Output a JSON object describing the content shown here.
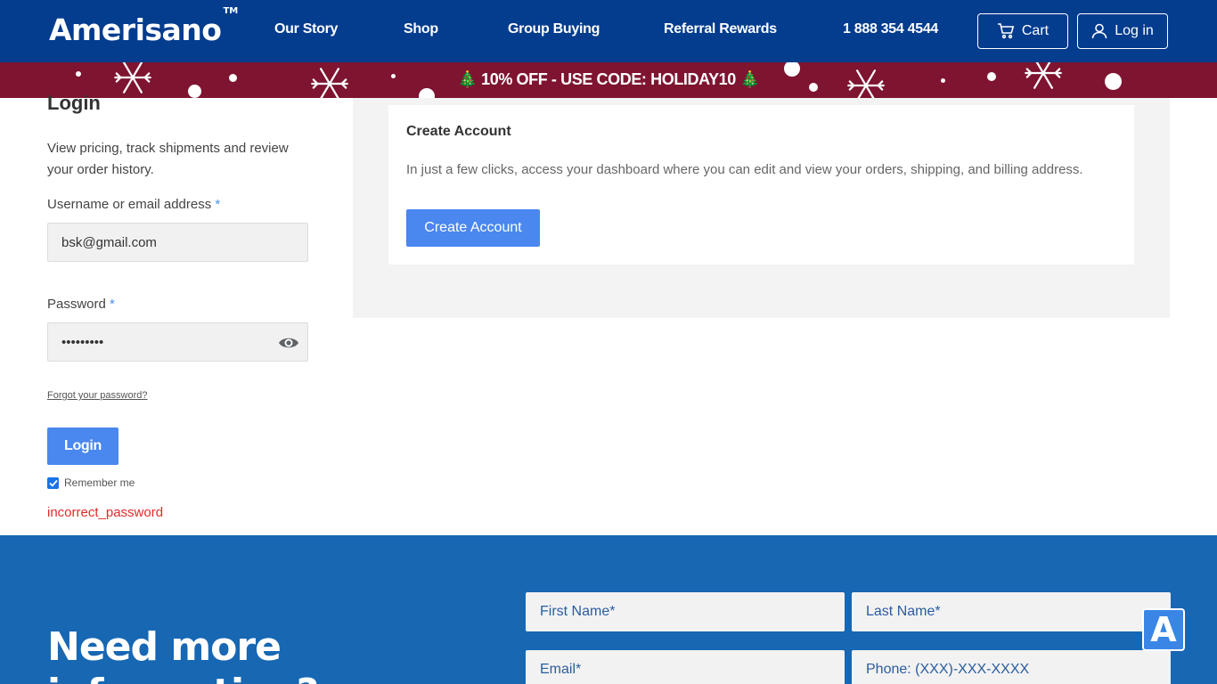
{
  "header": {
    "logo": "Amerisano",
    "logo_tm": "TM",
    "nav": [
      {
        "label": "Our Story"
      },
      {
        "label": "Shop"
      },
      {
        "label": "Group Buying"
      },
      {
        "label": "Referral Rewards"
      }
    ],
    "phone": "1 888 354 4544",
    "cart_label": "Cart",
    "login_label": "Log in",
    "bg_color": "#043c8e"
  },
  "promo": {
    "text": "🎄 10% OFF - USE CODE: HOLIDAY10 🎄",
    "bg_color": "#7e1430"
  },
  "login": {
    "title": "Login",
    "intro": "View pricing, track shipments and review your order history.",
    "username_label": "Username or email address",
    "username_value": "bsk@gmail.com",
    "password_label": "Password",
    "password_value": "•••••••••",
    "required_mark": "*",
    "forgot_link": "Forgot your password?",
    "login_button": "Login",
    "remember_label": "Remember me",
    "remember_checked": true,
    "error": "incorrect_password"
  },
  "create_account": {
    "title": "Create Account",
    "description": "In just a few clicks, access your dashboard where you can edit and view your orders, shipping, and billing address.",
    "button": "Create Account"
  },
  "info": {
    "heading": "Need more information?",
    "first_name_placeholder": "First Name*",
    "last_name_placeholder": "Last Name*",
    "email_placeholder": "Email*",
    "phone_placeholder": "Phone: (XXX)-XXX-XXXX",
    "bg_color": "#1767b3"
  },
  "widget": {
    "label": "A"
  }
}
